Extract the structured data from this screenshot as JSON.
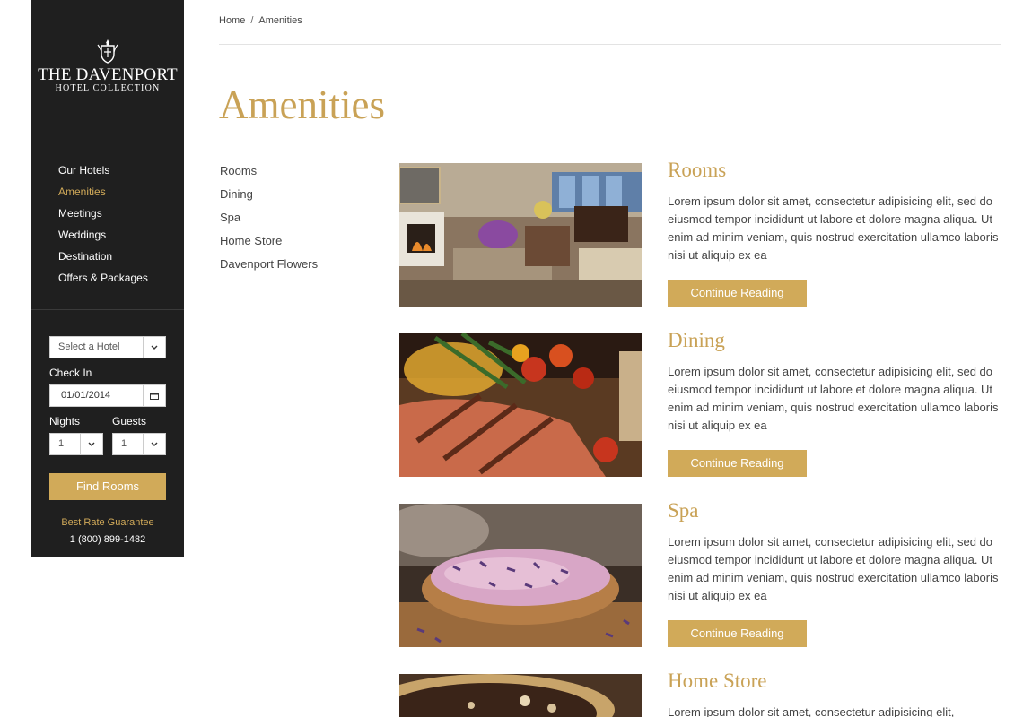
{
  "logo": {
    "title": "THE DAVENPORT",
    "subtitle": "HOTEL COLLECTION"
  },
  "nav": {
    "items": [
      {
        "label": "Our Hotels"
      },
      {
        "label": "Amenities"
      },
      {
        "label": "Meetings"
      },
      {
        "label": "Weddings"
      },
      {
        "label": "Destination"
      },
      {
        "label": "Offers & Packages"
      }
    ],
    "active_index": 1
  },
  "booking": {
    "hotel_select": "Select a Hotel",
    "checkin_label": "Check In",
    "checkin_value": "01/01/2014",
    "nights_label": "Nights",
    "nights_value": "1",
    "guests_label": "Guests",
    "guests_value": "1",
    "find_button": "Find Rooms",
    "rate_guarantee": "Best Rate Guarantee",
    "phone": "1 (800) 899-1482"
  },
  "breadcrumb": {
    "home": "Home",
    "separator": "/",
    "current": "Amenities"
  },
  "page_title": "Amenities",
  "subnav": [
    "Rooms",
    "Dining",
    "Spa",
    "Home Store",
    "Davenport Flowers"
  ],
  "amenities": [
    {
      "title": "Rooms",
      "text": "Lorem ipsum dolor sit amet, consectetur adipisicing elit, sed do eiusmod tempor incididunt ut labore et dolore magna aliqua. Ut enim ad minim veniam, quis nostrud exercitation ullamco laboris nisi ut aliquip ex ea",
      "button": "Continue Reading",
      "image": "hotel-lounge-photo"
    },
    {
      "title": "Dining",
      "text": "Lorem ipsum dolor sit amet, consectetur adipisicing elit, sed do eiusmod tempor incididunt ut labore et dolore magna aliqua. Ut enim ad minim veniam, quis nostrud exercitation ullamco laboris nisi ut aliquip ex ea",
      "button": "Continue Reading",
      "image": "grilled-salmon-photo"
    },
    {
      "title": "Spa",
      "text": "Lorem ipsum dolor sit amet, consectetur adipisicing elit, sed do eiusmod tempor incididunt ut labore et dolore magna aliqua. Ut enim ad minim veniam, quis nostrud exercitation ullamco laboris nisi ut aliquip ex ea",
      "button": "Continue Reading",
      "image": "lavender-salt-photo"
    },
    {
      "title": "Home Store",
      "text": "Lorem ipsum dolor sit amet, consectetur adipisicing elit,",
      "image": "home-store-photo"
    }
  ],
  "colors": {
    "accent": "#d1aa59",
    "title_gold": "#c9a256",
    "sidebar_bg": "#1f1f1f"
  }
}
